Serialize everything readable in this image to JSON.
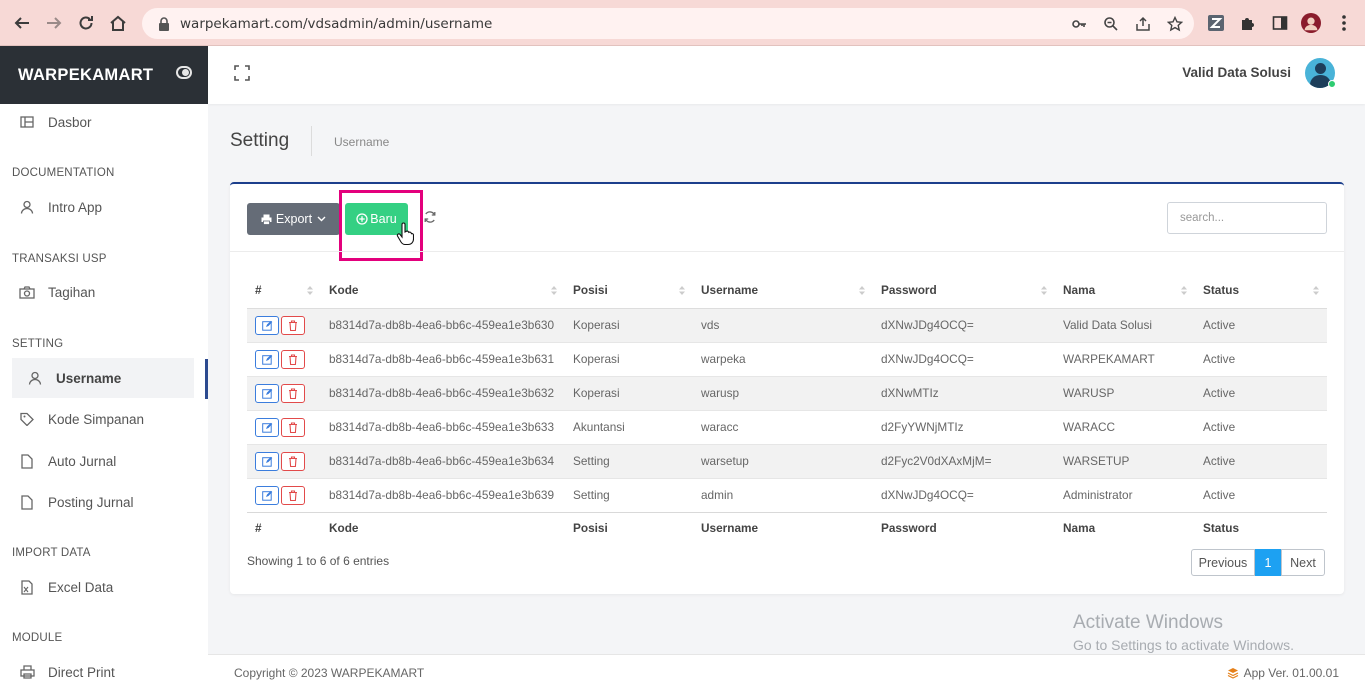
{
  "browser": {
    "url": "warpekamart.com/vdsadmin/admin/username"
  },
  "sidebar": {
    "brand": "WARPEKAMART",
    "dasbor": "Dasbor",
    "sections": {
      "documentation": "DOCUMENTATION",
      "transaksi": "TRANSAKSI USP",
      "setting": "SETTING",
      "import": "IMPORT DATA",
      "module": "MODULE"
    },
    "items": {
      "intro": "Intro App",
      "tagihan": "Tagihan",
      "username": "Username",
      "kode_simpanan": "Kode Simpanan",
      "auto_jurnal": "Auto Jurnal",
      "posting_jurnal": "Posting Jurnal",
      "excel_data": "Excel Data",
      "direct_print": "Direct Print"
    }
  },
  "header": {
    "user_name": "Valid Data Solusi"
  },
  "page": {
    "title": "Setting",
    "breadcrumb": "Username"
  },
  "toolbar": {
    "export_label": "Export",
    "baru_label": "Baru",
    "search_placeholder": "search..."
  },
  "table": {
    "columns": [
      "#",
      "Kode",
      "Posisi",
      "Username",
      "Password",
      "Nama",
      "Status"
    ],
    "rows": [
      {
        "kode": "b8314d7a-db8b-4ea6-bb6c-459ea1e3b630",
        "posisi": "Koperasi",
        "username": "vds",
        "password": "dXNwJDg4OCQ=",
        "nama": "Valid Data Solusi",
        "status": "Active"
      },
      {
        "kode": "b8314d7a-db8b-4ea6-bb6c-459ea1e3b631",
        "posisi": "Koperasi",
        "username": "warpeka",
        "password": "dXNwJDg4OCQ=",
        "nama": "WARPEKAMART",
        "status": "Active"
      },
      {
        "kode": "b8314d7a-db8b-4ea6-bb6c-459ea1e3b632",
        "posisi": "Koperasi",
        "username": "warusp",
        "password": "dXNwMTIz",
        "nama": "WARUSP",
        "status": "Active"
      },
      {
        "kode": "b8314d7a-db8b-4ea6-bb6c-459ea1e3b633",
        "posisi": "Akuntansi",
        "username": "waracc",
        "password": "d2FyYWNjMTIz",
        "nama": "WARACC",
        "status": "Active"
      },
      {
        "kode": "b8314d7a-db8b-4ea6-bb6c-459ea1e3b634",
        "posisi": "Setting",
        "username": "warsetup",
        "password": "d2Fyc2V0dXAxMjM=",
        "nama": "WARSETUP",
        "status": "Active"
      },
      {
        "kode": "b8314d7a-db8b-4ea6-bb6c-459ea1e3b639",
        "posisi": "Setting",
        "username": "admin",
        "password": "dXNwJDg4OCQ=",
        "nama": "Administrator",
        "status": "Active"
      }
    ],
    "info": "Showing 1 to 6 of 6 entries"
  },
  "pagination": {
    "previous": "Previous",
    "current": "1",
    "next": "Next"
  },
  "footer": {
    "copyright": "Copyright © 2023 WARPEKAMART",
    "version": "App Ver. 01.00.01"
  },
  "watermark": {
    "line1": "Activate Windows",
    "line2": "Go to Settings to activate Windows."
  },
  "colors": {
    "brand_bg": "#2b3036",
    "accent": "#1c3f8c",
    "baru_button": "#34d083",
    "highlight": "#e3007c"
  }
}
